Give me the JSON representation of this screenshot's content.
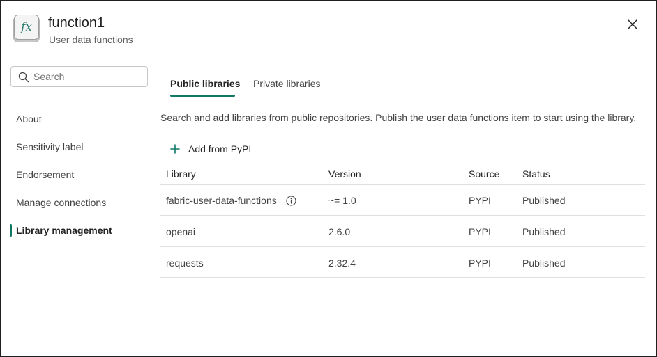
{
  "header": {
    "title": "function1",
    "subtitle": "User data functions",
    "app_icon": "fx-function-icon",
    "close_icon": "close-icon"
  },
  "search": {
    "placeholder": "Search",
    "value": ""
  },
  "sidebar": {
    "items": [
      {
        "label": "About",
        "active": false
      },
      {
        "label": "Sensitivity label",
        "active": false
      },
      {
        "label": "Endorsement",
        "active": false
      },
      {
        "label": "Manage connections",
        "active": false
      },
      {
        "label": "Library management",
        "active": true
      }
    ]
  },
  "tabs": [
    {
      "label": "Public libraries",
      "active": true
    },
    {
      "label": "Private libraries",
      "active": false
    }
  ],
  "description": "Search and add libraries from public repositories. Publish the user data functions item to start using the library.",
  "add_button": {
    "label": "Add from PyPI",
    "icon": "plus-icon"
  },
  "table": {
    "headers": [
      "Library",
      "Version",
      "Source",
      "Status"
    ],
    "rows": [
      {
        "library": "fabric-user-data-functions",
        "version": "~= 1.0",
        "source": "PYPI",
        "status": "Published",
        "info_icon": true
      },
      {
        "library": "openai",
        "version": "2.6.0",
        "source": "PYPI",
        "status": "Published",
        "info_icon": false
      },
      {
        "library": "requests",
        "version": "2.32.4",
        "source": "PYPI",
        "status": "Published",
        "info_icon": false
      }
    ]
  },
  "colors": {
    "accent": "#117865",
    "border": "#e0e0e0",
    "text": "#242424"
  }
}
